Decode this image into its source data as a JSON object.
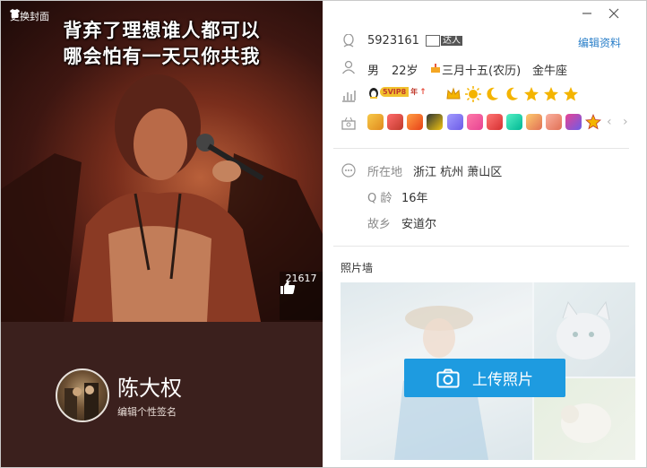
{
  "window": {
    "minimize_icon": "minimize-icon",
    "close_icon": "close-icon"
  },
  "cover": {
    "change_cover_label": "更换封面",
    "caption_line1": "背弃了理想谁人都可以",
    "caption_line2": "哪会怕有一天只你共我",
    "like_count": "21617"
  },
  "profile": {
    "nickname": "陈大权",
    "signature_placeholder": "编辑个性签名"
  },
  "account": {
    "qq_number": "5923161",
    "daren_badge": "达人",
    "edit_profile": "编辑资料"
  },
  "basic": {
    "gender": "男",
    "age": "22岁",
    "birthday": "三月十五(农历)",
    "zodiac": "金牛座"
  },
  "vip": {
    "badge_text": "5VIP8",
    "badge_suffix": "年",
    "badge_arrow": "↑"
  },
  "details": {
    "location_label": "所在地",
    "location_value": "浙江 杭州 萧山区",
    "qage_label": "Q 龄",
    "qage_value": "16年",
    "hometown_label": "故乡",
    "hometown_value": "安道尔"
  },
  "photo_wall": {
    "title": "照片墙",
    "upload_label": "上传照片"
  },
  "colors": {
    "left_bg": "#3b201d",
    "accent_blue": "#1e9be0",
    "link_blue": "#2a7fc9"
  }
}
